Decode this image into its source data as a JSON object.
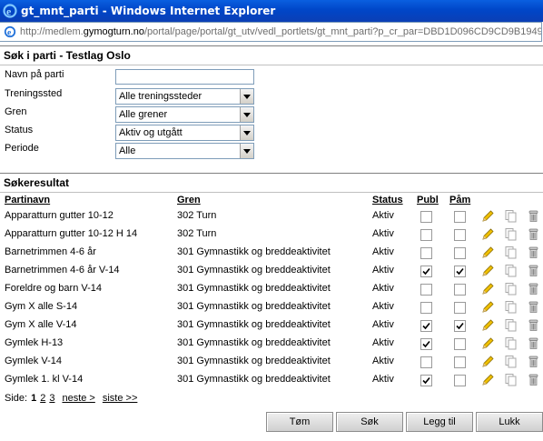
{
  "window": {
    "title": "gt_mnt_parti - Windows Internet Explorer"
  },
  "address": {
    "url_prefix": "http://medlem.",
    "url_domain": "gymogturn.no",
    "url_rest": "/portal/page/portal/gt_utv/vedl_portlets/gt_mnt_parti?p_cr_par=DBD1D096CD9CD9B1949"
  },
  "search": {
    "heading": "Søk i parti - Testlag Oslo",
    "fields": {
      "navn_label": "Navn på parti",
      "navn_value": "",
      "trening_label": "Treningssted",
      "trening_value": "Alle treningssteder",
      "gren_label": "Gren",
      "gren_value": "Alle grener",
      "status_label": "Status",
      "status_value": "Aktiv og utgått",
      "periode_label": "Periode",
      "periode_value": "Alle"
    }
  },
  "results": {
    "heading": "Søkeresultat",
    "columns": {
      "partinavn": "Partinavn",
      "gren": "Gren",
      "status": "Status",
      "publ": "Publ",
      "pam": "Påm"
    },
    "rows": [
      {
        "name": "Apparatturn gutter 10-12",
        "gren": "302 Turn",
        "status": "Aktiv",
        "publ": false,
        "pam": false
      },
      {
        "name": "Apparatturn gutter 10-12 H 14",
        "gren": "302 Turn",
        "status": "Aktiv",
        "publ": false,
        "pam": false
      },
      {
        "name": "Barnetrimmen 4-6 år",
        "gren": "301 Gymnastikk og breddeaktivitet",
        "status": "Aktiv",
        "publ": false,
        "pam": false
      },
      {
        "name": "Barnetrimmen 4-6 år V-14",
        "gren": "301 Gymnastikk og breddeaktivitet",
        "status": "Aktiv",
        "publ": true,
        "pam": true
      },
      {
        "name": "Foreldre og barn V-14",
        "gren": "301 Gymnastikk og breddeaktivitet",
        "status": "Aktiv",
        "publ": false,
        "pam": false
      },
      {
        "name": "Gym X alle S-14",
        "gren": "301 Gymnastikk og breddeaktivitet",
        "status": "Aktiv",
        "publ": false,
        "pam": false
      },
      {
        "name": "Gym X alle V-14",
        "gren": "301 Gymnastikk og breddeaktivitet",
        "status": "Aktiv",
        "publ": true,
        "pam": true
      },
      {
        "name": "Gymlek H-13",
        "gren": "301 Gymnastikk og breddeaktivitet",
        "status": "Aktiv",
        "publ": true,
        "pam": false
      },
      {
        "name": "Gymlek V-14",
        "gren": "301 Gymnastikk og breddeaktivitet",
        "status": "Aktiv",
        "publ": false,
        "pam": false
      },
      {
        "name": "Gymlek 1. kl V-14",
        "gren": "301 Gymnastikk og breddeaktivitet",
        "status": "Aktiv",
        "publ": true,
        "pam": false
      }
    ],
    "row_icons": [
      "edit-pencil-icon",
      "copy-icon",
      "delete-bin-icon"
    ]
  },
  "pager": {
    "label": "Side:",
    "current": "1",
    "pages": [
      "2",
      "3"
    ],
    "next": "neste >",
    "last": "siste >>"
  },
  "buttons": {
    "clear": "Tøm",
    "search": "Søk",
    "add": "Legg til",
    "close": "Lukk"
  },
  "colors": {
    "titlebar": "#0046c8",
    "field_border": "#7f9db9",
    "pencil": "#e8b400"
  }
}
